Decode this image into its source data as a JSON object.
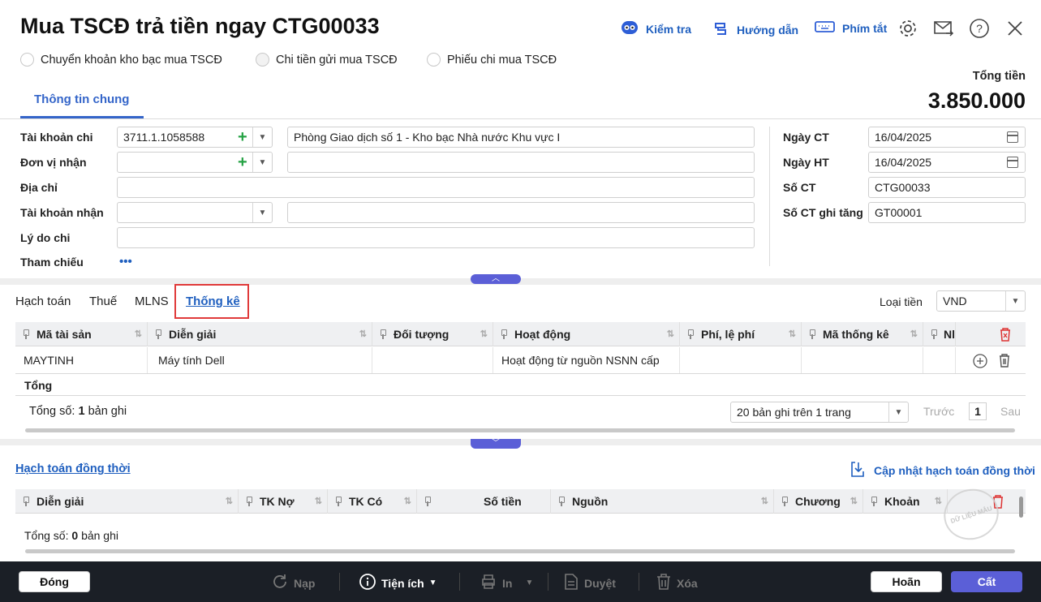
{
  "title": "Mua TSCĐ trả tiền ngay CTG00033",
  "toolbar": {
    "check": "Kiểm tra",
    "guide": "Hướng dẫn",
    "shortcuts": "Phím tắt"
  },
  "radios": [
    {
      "label": "Chuyển khoản kho bạc mua TSCĐ",
      "selected": false
    },
    {
      "label": "Chi tiền gửi mua TSCĐ",
      "selected": true
    },
    {
      "label": "Phiếu chi mua TSCĐ",
      "selected": false
    }
  ],
  "tab_general": "Thông tin chung",
  "total": {
    "label": "Tổng tiền",
    "value": "3.850.000"
  },
  "form": {
    "account_label": "Tài khoản chi",
    "account_value": "3711.1.1058588",
    "account_name": "Phòng Giao dịch số 1 - Kho bạc Nhà nước Khu vực I",
    "unit_label": "Đơn vị nhận",
    "unit_value": "",
    "unit_name": "",
    "address_label": "Địa chỉ",
    "address_value": "",
    "recv_account_label": "Tài khoản nhận",
    "recv_account_value": "",
    "recv_account_name": "",
    "reason_label": "Lý do chi",
    "reason_value": "",
    "reference_label": "Tham chiếu",
    "reference_more": "•••"
  },
  "right_form": {
    "date_ct_label": "Ngày CT",
    "date_ct": "16/04/2025",
    "date_ht_label": "Ngày HT",
    "date_ht": "16/04/2025",
    "so_ct_label": "Số CT",
    "so_ct": "CTG00033",
    "so_ct_gt_label": "Số CT ghi tăng",
    "so_ct_gt": "GT00001"
  },
  "subtabs": [
    "Hạch toán",
    "Thuế",
    "MLNS",
    "Thống kê"
  ],
  "currency": {
    "label": "Loại tiền",
    "value": "VND"
  },
  "grid1": {
    "headers": [
      "Mã tài sản",
      "Diễn giải",
      "Đối tượng",
      "Hoạt động",
      "Phí, lệ phí",
      "Mã thống kê",
      "Nl"
    ],
    "rows": [
      [
        "MAYTINH",
        "Máy tính Dell",
        "",
        "Hoạt động từ nguồn NSNN cấp",
        "",
        "",
        ""
      ]
    ],
    "total_label": "Tổng",
    "count_prefix": "Tổng số:",
    "count": "1",
    "count_suffix": "bản ghi",
    "page_size": "20 bản ghi trên 1 trang",
    "prev": "Trước",
    "page": "1",
    "next": "Sau"
  },
  "concurrent": {
    "title": "Hạch toán đồng thời",
    "update": "Cập nhật hạch toán đồng thời",
    "headers": [
      "Diễn giải",
      "TK Nợ",
      "TK Có",
      "Số tiền",
      "Nguồn",
      "Chương",
      "Khoản"
    ],
    "count_prefix": "Tổng số:",
    "count": "0",
    "count_suffix": "bản ghi"
  },
  "watermark": "DỮ LIỆU MẪU",
  "footer": {
    "close": "Đóng",
    "load": "Nạp",
    "utilities": "Tiện ích",
    "print": "In",
    "approve": "Duyệt",
    "delete": "Xóa",
    "cancel": "Hoãn",
    "save": "Cất"
  },
  "colors": {
    "accent": "#3465c9",
    "save": "#5b5fd7",
    "highlight_box": "#e03a3a",
    "footer_bg": "#1b1f26"
  }
}
